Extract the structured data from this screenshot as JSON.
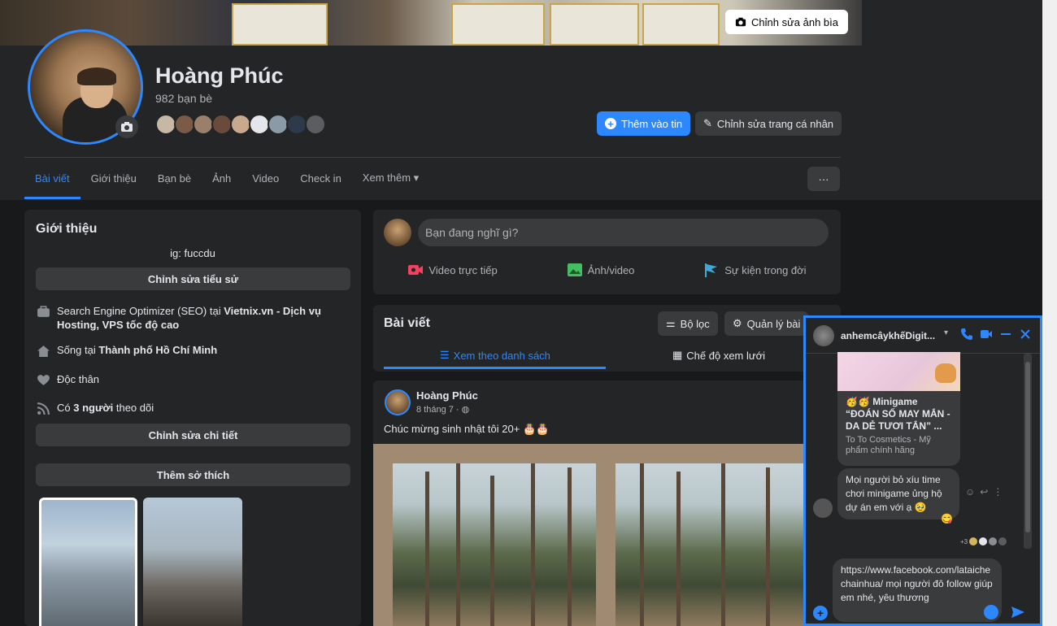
{
  "cover": {
    "edit_label": "Chỉnh sửa ảnh bìa"
  },
  "profile": {
    "name": "Hoàng Phúc",
    "friends_count": "982 bạn bè",
    "add_story_label": "Thêm vào tin",
    "edit_profile_label": "Chỉnh sửa trang cá nhân"
  },
  "tabs": [
    {
      "label": "Bài viết",
      "active": true
    },
    {
      "label": "Giới thiệu"
    },
    {
      "label": "Bạn bè"
    },
    {
      "label": "Ảnh"
    },
    {
      "label": "Video"
    },
    {
      "label": "Check in"
    },
    {
      "label": "Xem thêm ▾"
    }
  ],
  "more_label": "···",
  "intro": {
    "title": "Giới thiệu",
    "bio": "ig: fuccdu",
    "edit_bio_label": "Chỉnh sửa tiểu sử",
    "work_prefix": "Search Engine Optimizer (SEO) tại ",
    "work_company": "Vietnix.vn - Dịch vụ Hosting, VPS tốc độ cao",
    "lives_prefix": "Sống tại ",
    "lives_city": "Thành phố Hồ Chí Minh",
    "relationship": "Độc thân",
    "followers_prefix": "Có ",
    "followers_count": "3 người",
    "followers_suffix": " theo dõi",
    "edit_details_label": "Chỉnh sửa chi tiết",
    "add_hobbies_label": "Thêm sở thích"
  },
  "composer": {
    "placeholder": "Bạn đang nghĩ gì?",
    "live_label": "Video trực tiếp",
    "photo_label": "Ảnh/video",
    "event_label": "Sự kiện trong đời"
  },
  "posts": {
    "title": "Bài viết",
    "filter_label": "Bộ lọc",
    "manage_label": "Quản lý bài",
    "list_view_label": "Xem theo danh sách",
    "grid_view_label": "Chế độ xem lưới"
  },
  "post": {
    "author": "Hoàng Phúc",
    "date": "8 tháng 7 · ",
    "text": "Chúc mừng sinh nhật tôi 20+ 🎂🎂"
  },
  "chat": {
    "name": "anhemcâykhếDigit...",
    "card_title": "🥳🥳 Minigame “ĐOÁN SỐ MAY MẮN - DA DẺ TƯƠI TẮN” ...",
    "card_source": "To To Cosmetics - Mỹ phẩm chính hãng",
    "message": "Mọi người bỏ xíu time chơi minigame ủng hộ dự án em với ạ 🥹",
    "reaction": "😋",
    "seen_more": "+3",
    "draft": "https://www.facebook.com/lataichechainhua/ mọi người đô follow giúp em nhé, yêu thương"
  },
  "colors": {
    "accent": "#2d88ff",
    "background": "#18191a",
    "card": "#242526",
    "button": "#3a3b3c"
  }
}
